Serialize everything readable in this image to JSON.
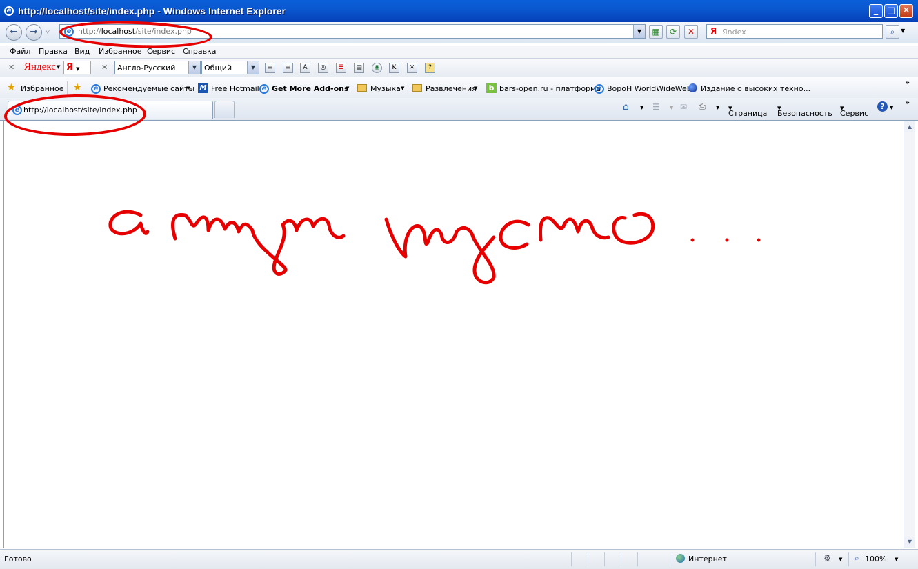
{
  "window": {
    "title": "http://localhost/site/index.php - Windows Internet Explorer"
  },
  "address": {
    "prefix": "http://",
    "host": "localhost",
    "path": "/site/index.php"
  },
  "search": {
    "logo": "Я",
    "placeholder": "Яndex"
  },
  "menu": [
    "Файл",
    "Правка",
    "Вид",
    "Избранное",
    "Сервис",
    "Справка"
  ],
  "yandex_toolbar": {
    "brand": "Яндекс",
    "ya_button": "Я",
    "dictionary": "Англо-Русский",
    "topic": "Общий"
  },
  "favorites": {
    "label": "Избранное",
    "items": [
      "Рекомендуемые сайты",
      "Free Hotmail",
      "Get More Add-ons",
      "Музыка",
      "Развлечения",
      "bars-open.ru - платформа",
      "ВороН WorldWideWeb",
      "Издание о высоких техно..."
    ]
  },
  "tab": {
    "title": "http://localhost/site/index.php"
  },
  "command_bar": {
    "page": "Страница",
    "safety": "Безопасность",
    "tools": "Сервис"
  },
  "content": {
    "handwriting": "а тут пусто ..."
  },
  "status": {
    "text": "Готово",
    "zone": "Интернет",
    "zoom": "100%"
  },
  "colors": {
    "titlebar": "#0a58d0",
    "annotation": "#e60000"
  }
}
